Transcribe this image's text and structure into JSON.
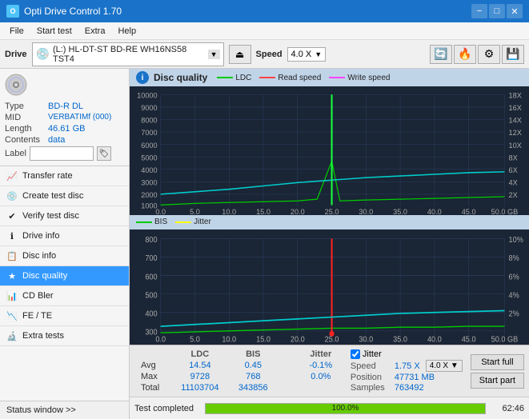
{
  "titlebar": {
    "title": "Opti Drive Control 1.70",
    "min": "−",
    "max": "□",
    "close": "✕"
  },
  "menu": {
    "items": [
      "File",
      "Start test",
      "Extra",
      "Help"
    ]
  },
  "drive": {
    "label": "Drive",
    "drive_name": "(L:)  HL-DT-ST BD-RE  WH16NS58 TST4",
    "speed_label": "Speed",
    "speed_value": "4.0 X"
  },
  "disc": {
    "type_label": "Type",
    "type_value": "BD-R DL",
    "mid_label": "MID",
    "mid_value": "VERBATIMf (000)",
    "length_label": "Length",
    "length_value": "46.61 GB",
    "contents_label": "Contents",
    "contents_value": "data",
    "label_label": "Label"
  },
  "nav": {
    "items": [
      {
        "id": "transfer-rate",
        "label": "Transfer rate",
        "icon": "📈"
      },
      {
        "id": "create-test-disc",
        "label": "Create test disc",
        "icon": "💿"
      },
      {
        "id": "verify-test-disc",
        "label": "Verify test disc",
        "icon": "✔"
      },
      {
        "id": "drive-info",
        "label": "Drive info",
        "icon": "ℹ"
      },
      {
        "id": "disc-info",
        "label": "Disc info",
        "icon": "📋"
      },
      {
        "id": "disc-quality",
        "label": "Disc quality",
        "icon": "★",
        "active": true
      },
      {
        "id": "cd-bler",
        "label": "CD Bler",
        "icon": "📊"
      },
      {
        "id": "fe-te",
        "label": "FE / TE",
        "icon": "📉"
      },
      {
        "id": "extra-tests",
        "label": "Extra tests",
        "icon": "🔬"
      }
    ],
    "status_window": "Status window >>"
  },
  "chart": {
    "title": "Disc quality",
    "legend": [
      {
        "label": "LDC",
        "color": "#00cc00"
      },
      {
        "label": "Read speed",
        "color": "#ff0000"
      },
      {
        "label": "Write speed",
        "color": "#ff00ff"
      }
    ],
    "legend2": [
      {
        "label": "BIS",
        "color": "#00cc00"
      },
      {
        "label": "Jitter",
        "color": "#ffff00"
      }
    ],
    "top_ymax": 10000,
    "top_yaxis_right": [
      "18X",
      "16X",
      "14X",
      "12X",
      "10X",
      "8X",
      "6X",
      "4X",
      "2X"
    ],
    "bottom_ymax": 800,
    "bottom_yaxis_right": [
      "10%",
      "8%",
      "6%",
      "4%",
      "2%"
    ],
    "xmax": 50,
    "stats": {
      "headers": [
        "",
        "LDC",
        "BIS",
        "",
        "Jitter",
        "Speed",
        ""
      ],
      "avg": {
        "label": "Avg",
        "ldc": "14.54",
        "bis": "0.45",
        "jitter": "-0.1%",
        "speed_label": "1.75 X"
      },
      "max": {
        "label": "Max",
        "ldc": "9728",
        "bis": "768",
        "jitter": "0.0%",
        "position_label": "47731 MB"
      },
      "total": {
        "label": "Total",
        "ldc": "11103704",
        "bis": "343856"
      },
      "speed_display": "4.0 X",
      "jitter_checked": true,
      "jitter_label": "Jitter",
      "speed_val_label": "Speed",
      "speed_val": "1.75 X",
      "position_label": "Position",
      "position_val": "47731 MB",
      "samples_label": "Samples",
      "samples_val": "763492",
      "start_full": "Start full",
      "start_part": "Start part"
    }
  },
  "statusbar": {
    "text": "Test completed",
    "progress": 100,
    "time": "62:46"
  }
}
